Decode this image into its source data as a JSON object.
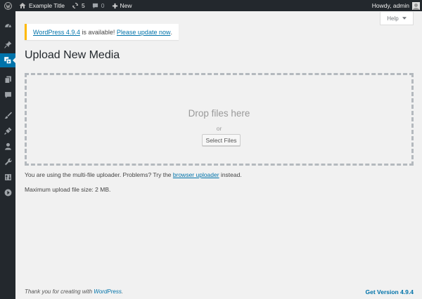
{
  "adminbar": {
    "site_title": "Example Title",
    "updates_count": "5",
    "comments_count": "0",
    "new_label": "New",
    "greeting": "Howdy, admin"
  },
  "help": {
    "label": "Help"
  },
  "notice": {
    "link_version": "WordPress 4.9.4",
    "text_middle": " is available! ",
    "link_update": "Please update now",
    "text_end": "."
  },
  "page": {
    "title": "Upload New Media"
  },
  "uploader": {
    "drop_title": "Drop files here",
    "or_text": "or",
    "select_button": "Select Files",
    "multi_text_before": "You are using the multi-file uploader. Problems? Try the ",
    "browser_link": "browser uploader",
    "multi_text_after": " instead.",
    "max_size": "Maximum upload file size: 2 MB."
  },
  "footer": {
    "thanks_before": "Thank you for creating with ",
    "wordpress_link": "WordPress",
    "thanks_after": ".",
    "version_link": "Get Version 4.9.4"
  },
  "sidebar": {
    "items": [
      {
        "icon": "dashboard-icon"
      },
      {
        "icon": "posts-pin-icon"
      },
      {
        "icon": "media-icon",
        "current": true
      },
      {
        "icon": "pages-icon"
      },
      {
        "icon": "comments-icon"
      },
      {
        "icon": "appearance-brush-icon"
      },
      {
        "icon": "plugins-icon"
      },
      {
        "icon": "users-icon"
      },
      {
        "icon": "tools-wrench-icon"
      },
      {
        "icon": "settings-icon"
      },
      {
        "icon": "collapse-menu-icon"
      }
    ]
  },
  "colors": {
    "adminbar_bg": "#23282d",
    "accent": "#0073aa",
    "notice_border": "#ffb900",
    "background": "#f1f1f1"
  }
}
